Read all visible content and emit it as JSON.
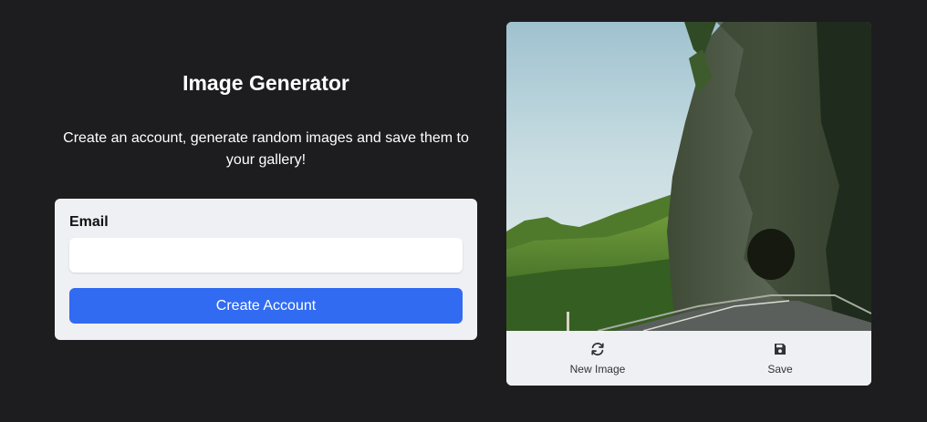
{
  "header": {
    "title": "Image Generator",
    "subtitle": "Create an account, generate random images and save them to your gallery!"
  },
  "form": {
    "email_label": "Email",
    "email_value": "",
    "email_placeholder": "",
    "submit_label": "Create Account"
  },
  "preview": {
    "alt": "mountain road tunnel",
    "actions": [
      {
        "label": "New Image",
        "icon": "refresh-icon"
      },
      {
        "label": "Save",
        "icon": "floppy-disk-icon"
      }
    ]
  },
  "colors": {
    "background": "#1d1d1f",
    "card": "#eff0f4",
    "accent": "#316bf2"
  }
}
